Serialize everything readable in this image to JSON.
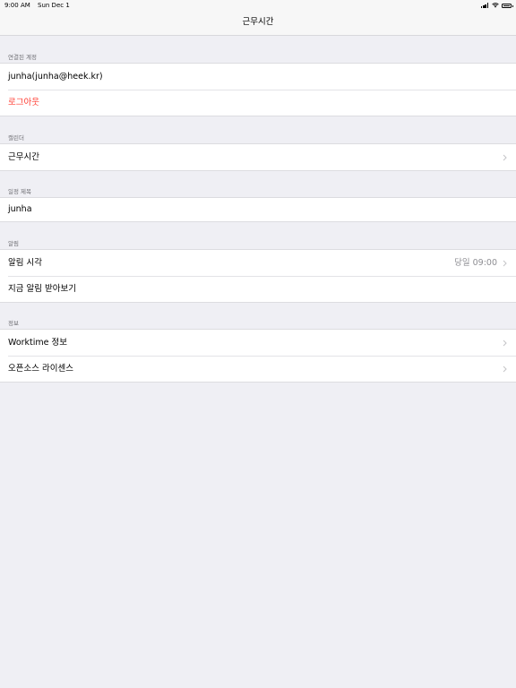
{
  "status_bar": {
    "time": "9:00 AM",
    "date": "Sun Dec 1"
  },
  "nav": {
    "title": "근무시간"
  },
  "sections": {
    "account": {
      "header": "연결된 계정",
      "account_label": "junha(junha@heek.kr)",
      "logout_label": "로그아웃"
    },
    "calendar": {
      "header": "캘린더",
      "calendar_label": "근무시간"
    },
    "event_title": {
      "header": "일정 제목",
      "value": "junha"
    },
    "alarm": {
      "header": "알림",
      "alarm_time_label": "알림 시각",
      "alarm_time_value": "당일 09:00",
      "receive_now_label": "지금 알림 받아보기"
    },
    "info": {
      "header": "정보",
      "about_label": "Worktime 정보",
      "license_label": "오픈소스 라이센스"
    }
  },
  "colors": {
    "destructive": "#ff3b30",
    "background": "#efeff4",
    "secondary_text": "#8e8e93"
  }
}
